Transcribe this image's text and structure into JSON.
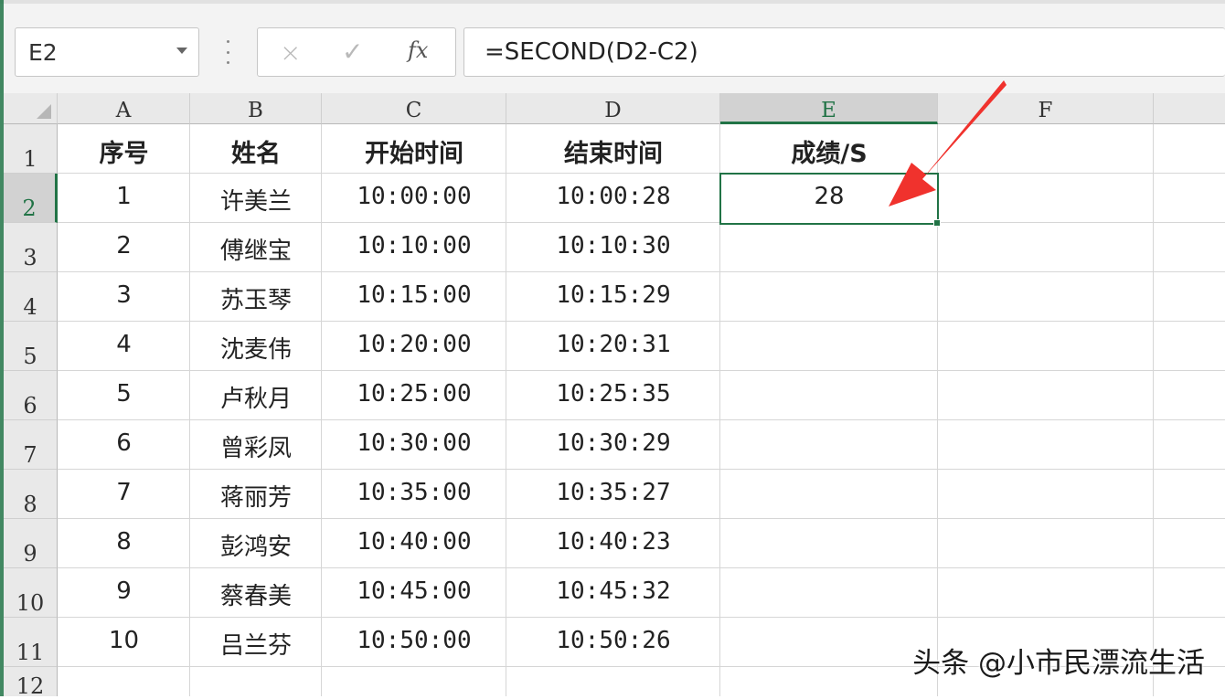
{
  "name_box": {
    "value": "E2"
  },
  "formula_bar": {
    "cancel_icon": "×",
    "enter_icon": "✓",
    "fx_label": "fx",
    "formula": "=SECOND(D2-C2)"
  },
  "columns": [
    "A",
    "B",
    "C",
    "D",
    "E",
    "F"
  ],
  "selected_column": "E",
  "rows": [
    "1",
    "2",
    "3",
    "4",
    "5",
    "6",
    "7",
    "8",
    "9",
    "10",
    "11",
    "12"
  ],
  "selected_row": "2",
  "headers": {
    "a": "序号",
    "b": "姓名",
    "c": "开始时间",
    "d": "结束时间",
    "e": "成绩/S"
  },
  "table": [
    {
      "seq": "1",
      "name": "许美兰",
      "start": "10:00:00",
      "end": "10:00:28",
      "score": "28"
    },
    {
      "seq": "2",
      "name": "傅继宝",
      "start": "10:10:00",
      "end": "10:10:30",
      "score": ""
    },
    {
      "seq": "3",
      "name": "苏玉琴",
      "start": "10:15:00",
      "end": "10:15:29",
      "score": ""
    },
    {
      "seq": "4",
      "name": "沈麦伟",
      "start": "10:20:00",
      "end": "10:20:31",
      "score": ""
    },
    {
      "seq": "5",
      "name": "卢秋月",
      "start": "10:25:00",
      "end": "10:25:35",
      "score": ""
    },
    {
      "seq": "6",
      "name": "曾彩凤",
      "start": "10:30:00",
      "end": "10:30:29",
      "score": ""
    },
    {
      "seq": "7",
      "name": "蒋丽芳",
      "start": "10:35:00",
      "end": "10:35:27",
      "score": ""
    },
    {
      "seq": "8",
      "name": "彭鸿安",
      "start": "10:40:00",
      "end": "10:40:23",
      "score": ""
    },
    {
      "seq": "9",
      "name": "蔡春美",
      "start": "10:45:00",
      "end": "10:45:32",
      "score": ""
    },
    {
      "seq": "10",
      "name": "吕兰芬",
      "start": "10:50:00",
      "end": "10:50:26",
      "score": ""
    }
  ],
  "watermark": "头条 @小市民漂流生活",
  "colors": {
    "accent": "#217346",
    "annotation_arrow": "#f0322d"
  }
}
